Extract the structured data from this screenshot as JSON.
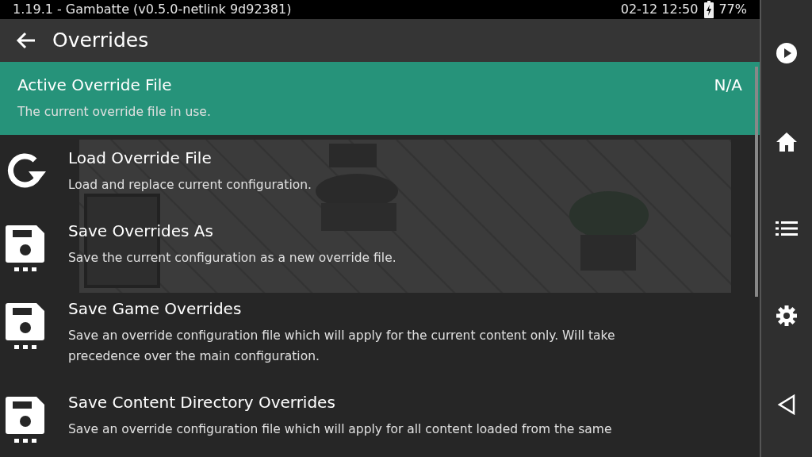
{
  "status_bar": {
    "title": "1.19.1 - Gambatte (v0.5.0-netlink 9d92381)",
    "datetime": "02-12 12:50",
    "battery": "77%"
  },
  "header": {
    "title": "Overrides"
  },
  "items": [
    {
      "kind": "value",
      "title": "Active Override File",
      "description": "The current override file in use.",
      "value": "N/A",
      "selected": true
    },
    {
      "kind": "load",
      "title": "Load Override File",
      "description": "Load and replace current configuration.",
      "selected": false
    },
    {
      "kind": "save",
      "title": "Save Overrides As",
      "description": "Save the current configuration as a new override file.",
      "selected": false
    },
    {
      "kind": "save",
      "title": "Save Game Overrides",
      "description": "Save an override configuration file which will apply for the current content only. Will take precedence over the main configuration.",
      "selected": false
    },
    {
      "kind": "save",
      "title": "Save Content Directory Overrides",
      "description": "Save an override configuration file which will apply for all content loaded from the same",
      "selected": false
    }
  ]
}
